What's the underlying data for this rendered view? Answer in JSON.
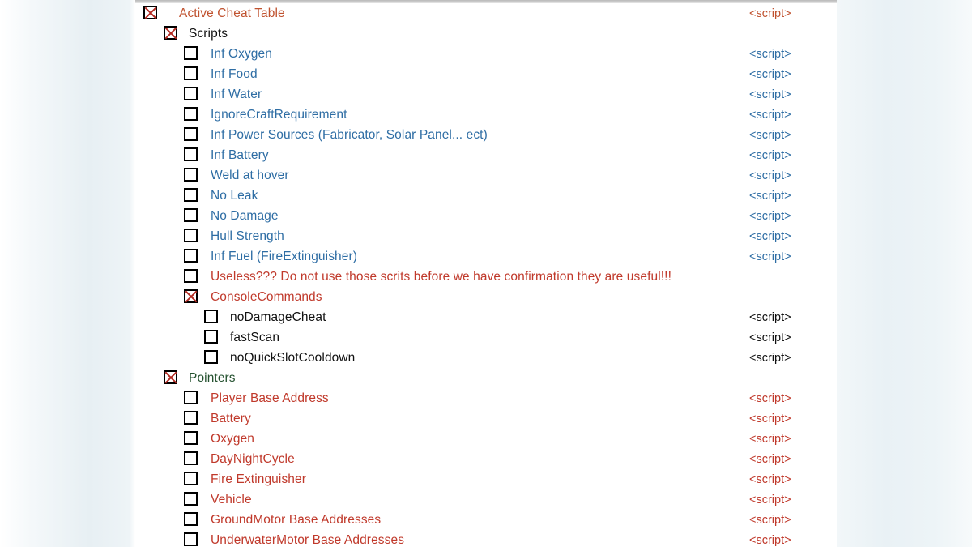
{
  "window": {
    "title": "Active Cheat Table",
    "script_label": "<script>"
  },
  "colors": {
    "brick": "#c0522f",
    "blue": "#2e6da4",
    "red": "#c0392b",
    "green": "#24512f",
    "black": "#111111",
    "checkbox_mark": "#b32a22",
    "panel_background": "#ffffff"
  },
  "tree": {
    "rows": [
      {
        "label": "Active Cheat Table",
        "level": 0,
        "checked": true,
        "color": "brick",
        "script": "<script>",
        "script_color": "brick"
      },
      {
        "label": "Scripts",
        "level": 1,
        "checked": true,
        "color": "black",
        "script": "",
        "script_color": "black"
      },
      {
        "label": "Inf Oxygen",
        "level": 2,
        "checked": false,
        "color": "blue",
        "script": "<script>",
        "script_color": "blue"
      },
      {
        "label": "Inf Food",
        "level": 2,
        "checked": false,
        "color": "blue",
        "script": "<script>",
        "script_color": "blue"
      },
      {
        "label": "Inf Water",
        "level": 2,
        "checked": false,
        "color": "blue",
        "script": "<script>",
        "script_color": "blue"
      },
      {
        "label": "IgnoreCraftRequirement",
        "level": 2,
        "checked": false,
        "color": "blue",
        "script": "<script>",
        "script_color": "blue"
      },
      {
        "label": "Inf Power Sources (Fabricator, Solar Panel... ect)",
        "level": 2,
        "checked": false,
        "color": "blue",
        "script": "<script>",
        "script_color": "blue"
      },
      {
        "label": "Inf Battery",
        "level": 2,
        "checked": false,
        "color": "blue",
        "script": "<script>",
        "script_color": "blue"
      },
      {
        "label": "Weld at hover",
        "level": 2,
        "checked": false,
        "color": "blue",
        "script": "<script>",
        "script_color": "blue"
      },
      {
        "label": "No Leak",
        "level": 2,
        "checked": false,
        "color": "blue",
        "script": "<script>",
        "script_color": "blue"
      },
      {
        "label": "No Damage",
        "level": 2,
        "checked": false,
        "color": "blue",
        "script": "<script>",
        "script_color": "blue"
      },
      {
        "label": "Hull Strength",
        "level": 2,
        "checked": false,
        "color": "blue",
        "script": "<script>",
        "script_color": "blue"
      },
      {
        "label": "Inf Fuel (FireExtinguisher)",
        "level": 2,
        "checked": false,
        "color": "blue",
        "script": "<script>",
        "script_color": "blue"
      },
      {
        "label": "Useless??? Do not use those scrits before we have confirmation they are useful!!!",
        "level": 2,
        "checked": false,
        "color": "red",
        "script": "",
        "script_color": "red"
      },
      {
        "label": "ConsoleCommands",
        "level": 2,
        "checked": true,
        "color": "red",
        "script": "",
        "script_color": "red"
      },
      {
        "label": "noDamageCheat",
        "level": 3,
        "checked": false,
        "color": "black",
        "script": "<script>",
        "script_color": "black"
      },
      {
        "label": "fastScan",
        "level": 3,
        "checked": false,
        "color": "black",
        "script": "<script>",
        "script_color": "black"
      },
      {
        "label": "noQuickSlotCooldown",
        "level": 3,
        "checked": false,
        "color": "black",
        "script": "<script>",
        "script_color": "black"
      },
      {
        "label": "Pointers",
        "level": 1,
        "checked": true,
        "color": "green",
        "script": "",
        "script_color": "green"
      },
      {
        "label": "Player Base Address",
        "level": 2,
        "checked": false,
        "color": "red",
        "script": "<script>",
        "script_color": "red"
      },
      {
        "label": "Battery",
        "level": 2,
        "checked": false,
        "color": "red",
        "script": "<script>",
        "script_color": "red"
      },
      {
        "label": "Oxygen",
        "level": 2,
        "checked": false,
        "color": "red",
        "script": "<script>",
        "script_color": "red"
      },
      {
        "label": "DayNightCycle",
        "level": 2,
        "checked": false,
        "color": "red",
        "script": "<script>",
        "script_color": "red"
      },
      {
        "label": "Fire Extinguisher",
        "level": 2,
        "checked": false,
        "color": "red",
        "script": "<script>",
        "script_color": "red"
      },
      {
        "label": "Vehicle",
        "level": 2,
        "checked": false,
        "color": "red",
        "script": "<script>",
        "script_color": "red"
      },
      {
        "label": "GroundMotor Base Addresses",
        "level": 2,
        "checked": false,
        "color": "red",
        "script": "<script>",
        "script_color": "red"
      },
      {
        "label": "UnderwaterMotor Base Addresses",
        "level": 2,
        "checked": false,
        "color": "red",
        "script": "<script>",
        "script_color": "red"
      }
    ]
  }
}
